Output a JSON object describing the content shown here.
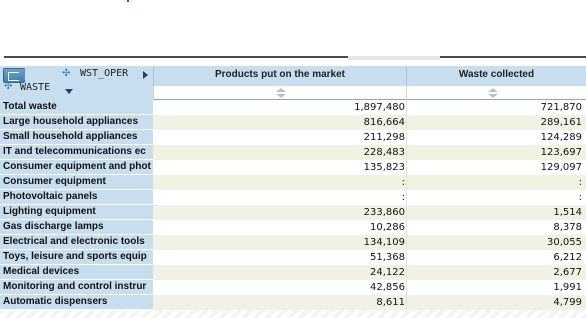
{
  "dimensions": {
    "column_dim_label": "WST_OPER",
    "row_dim_label": "WASTE"
  },
  "columns": [
    "Products put on the market",
    "Waste collected"
  ],
  "rows": [
    {
      "label": "Total waste",
      "values": [
        "1,897,480",
        "721,870"
      ]
    },
    {
      "label": "Large household appliances",
      "values": [
        "816,664",
        "289,161"
      ]
    },
    {
      "label": "Small household appliances",
      "values": [
        "211,298",
        "124,289"
      ]
    },
    {
      "label": "IT and telecommunications ec",
      "values": [
        "228,483",
        "123,697"
      ]
    },
    {
      "label": "Consumer equipment and phot",
      "values": [
        "135,823",
        "129,097"
      ]
    },
    {
      "label": "Consumer equipment",
      "values": [
        ":",
        ":"
      ]
    },
    {
      "label": "Photovoltaic panels",
      "values": [
        ":",
        ":"
      ]
    },
    {
      "label": "Lighting equipment",
      "values": [
        "233,860",
        "1,514"
      ]
    },
    {
      "label": "Gas discharge lamps",
      "values": [
        "10,286",
        "8,378"
      ]
    },
    {
      "label": "Electrical and electronic tools",
      "values": [
        "134,109",
        "30,055"
      ]
    },
    {
      "label": "Toys, leisure and sports equip",
      "values": [
        "51,368",
        "6,212"
      ]
    },
    {
      "label": "Medical devices",
      "values": [
        "24,122",
        "2,677"
      ]
    },
    {
      "label": "Monitoring and control instrur",
      "values": [
        "42,856",
        "1,991"
      ]
    },
    {
      "label": "Automatic dispensers",
      "values": [
        "8,611",
        "4,799"
      ]
    }
  ],
  "colors": {
    "header_bg": "#c8deef",
    "odd_row_bg": "#f2f2e4",
    "accent_arrow": "#1f3f6d"
  }
}
